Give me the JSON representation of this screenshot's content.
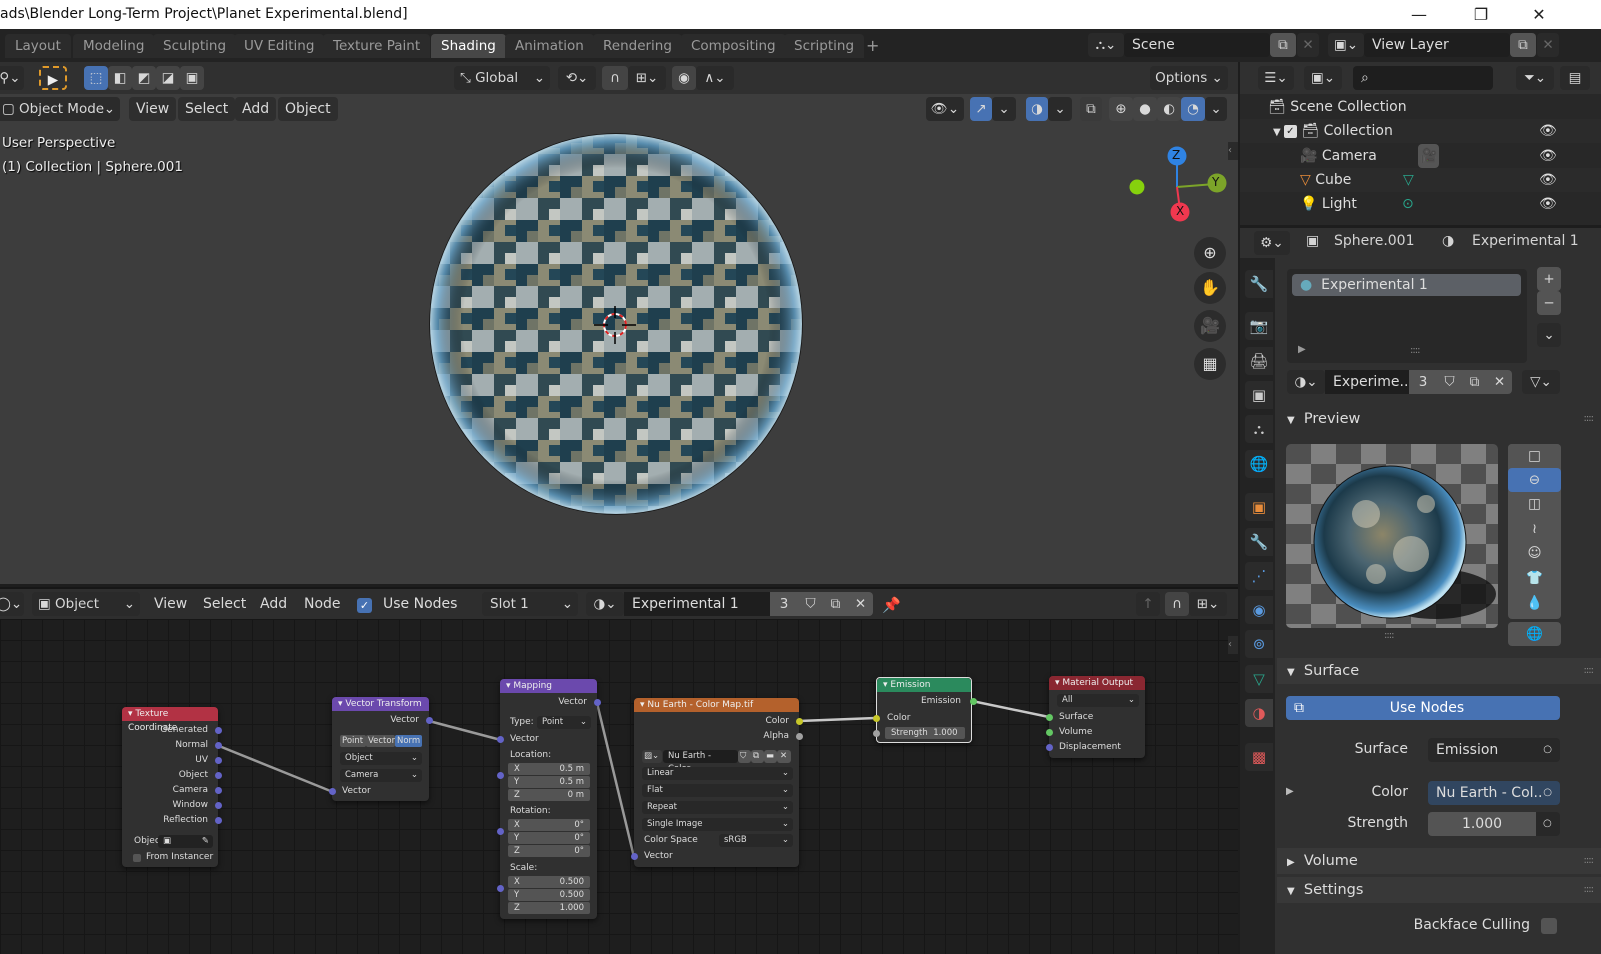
{
  "window": {
    "title": "ads\\Blender Long-Term Project\\Planet Experimental.blend]",
    "controls": {
      "minimize": "—",
      "maximize": "❐",
      "close": "✕"
    }
  },
  "workspace_tabs": [
    {
      "label": "Layout"
    },
    {
      "label": "Modeling"
    },
    {
      "label": "Sculpting"
    },
    {
      "label": "UV Editing"
    },
    {
      "label": "Texture Paint"
    },
    {
      "label": "Shading",
      "active": true
    },
    {
      "label": "Animation"
    },
    {
      "label": "Rendering"
    },
    {
      "label": "Compositing"
    },
    {
      "label": "Scripting"
    }
  ],
  "add_workspace": "+",
  "scene": {
    "name": "Scene",
    "view_layer": "View Layer"
  },
  "viewport": {
    "transform_orientation": "Global",
    "options_label": "Options",
    "mode": "Object Mode",
    "menus": [
      "View",
      "Select",
      "Add",
      "Object"
    ],
    "overlay_line1": "User Perspective",
    "overlay_line2": "(1) Collection | Sphere.001",
    "gizmo": {
      "z": "Z",
      "y": "Y",
      "x": "X"
    },
    "colors": {
      "x": "#f0384f",
      "y": "#7ca429",
      "z": "#2f83e3"
    }
  },
  "node_editor": {
    "editor_type": "Object",
    "menus": [
      "View",
      "Select",
      "Add",
      "Node"
    ],
    "use_nodes_label": "Use Nodes",
    "use_nodes_checked": true,
    "slot": "Slot 1",
    "material": "Experimental 1",
    "users": "3",
    "nodes": {
      "tex_coord": {
        "title": "Texture Coordinate",
        "outputs": [
          "Generated",
          "Normal",
          "UV",
          "Object",
          "Camera",
          "Window",
          "Reflection"
        ],
        "object_label": "Objec",
        "from_instancer": "From Instancer"
      },
      "vector_transform": {
        "title": "Vector Transform",
        "output": "Vector",
        "types": [
          "Point",
          "Vector",
          "Norm"
        ],
        "active_type": "Norm",
        "from": "Object",
        "to": "Camera",
        "input": "Vector"
      },
      "mapping": {
        "title": "Mapping",
        "output": "Vector",
        "type_label": "Type:",
        "type_value": "Point",
        "input": "Vector",
        "location_label": "Location:",
        "location": [
          {
            "axis": "X",
            "value": "0.5 m"
          },
          {
            "axis": "Y",
            "value": "0.5 m"
          },
          {
            "axis": "Z",
            "value": "0 m"
          }
        ],
        "rotation_label": "Rotation:",
        "rotation": [
          {
            "axis": "X",
            "value": "0°"
          },
          {
            "axis": "Y",
            "value": "0°"
          },
          {
            "axis": "Z",
            "value": "0°"
          }
        ],
        "scale_label": "Scale:",
        "scale": [
          {
            "axis": "X",
            "value": "0.500"
          },
          {
            "axis": "Y",
            "value": "0.500"
          },
          {
            "axis": "Z",
            "value": "1.000"
          }
        ]
      },
      "image_texture": {
        "title": "Nu Earth - Color Map.tif",
        "outputs": [
          "Color",
          "Alpha"
        ],
        "image_name": "Nu Earth - Color ..",
        "interpolation": "Linear",
        "projection": "Flat",
        "extension": "Repeat",
        "source": "Single Image",
        "color_space_label": "Color Space",
        "color_space": "sRGB",
        "input": "Vector"
      },
      "emission": {
        "title": "Emission",
        "output": "Emission",
        "color_label": "Color",
        "strength_label": "Strength",
        "strength": "1.000"
      },
      "material_output": {
        "title": "Material Output",
        "target": "All",
        "inputs": [
          "Surface",
          "Volume",
          "Displacement"
        ]
      }
    }
  },
  "outliner": {
    "search_placeholder": "",
    "root": "Scene Collection",
    "items": [
      {
        "name": "Collection",
        "level": 0
      },
      {
        "name": "Camera",
        "level": 1
      },
      {
        "name": "Cube",
        "level": 1
      },
      {
        "name": "Light",
        "level": 1
      }
    ]
  },
  "properties": {
    "object_name": "Sphere.001",
    "material_name": "Experimental 1",
    "slot_list": [
      "Experimental 1"
    ],
    "material_field": "Experime..",
    "users": "3",
    "sections": {
      "preview": "Preview",
      "surface": "Surface",
      "volume": "Volume",
      "settings": "Settings"
    },
    "use_nodes_button": "Use Nodes",
    "surface_label": "Surface",
    "surface_value": "Emission",
    "color_label": "Color",
    "color_value": "Nu Earth - Col..",
    "strength_label": "Strength",
    "strength_value": "1.000",
    "backface_culling_label": "Backface Culling",
    "backface_culling": false
  }
}
